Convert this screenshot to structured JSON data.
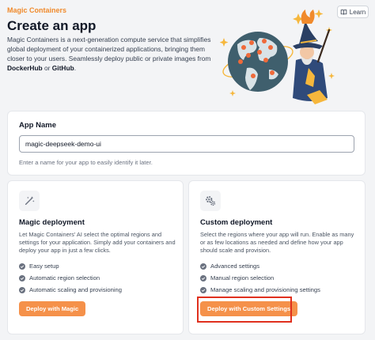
{
  "header": {
    "breadcrumb": "Magic Containers",
    "title": "Create an app",
    "intro_text": "Magic Containers is a next-generation compute service that simplifies global deployment of your containerized applications, bringing them closer to your users. Seamlessly deploy public or private images from ",
    "intro_dockerhub": "DockerHub",
    "intro_or": " or ",
    "intro_github": "GitHub",
    "intro_end": ".",
    "learn_label": "Learn"
  },
  "app_name": {
    "label": "App Name",
    "value": "magic-deepseek-demo-ui",
    "help": "Enter a name for your app to easily identify it later."
  },
  "magic_deployment": {
    "title": "Magic deployment",
    "description": "Let Magic Containers' AI select the optimal regions and settings for your application. Simply add your containers and deploy your app in just a few clicks.",
    "features": [
      "Easy setup",
      "Automatic region selection",
      "Automatic scaling and provisioning"
    ],
    "button_label": "Deploy with Magic"
  },
  "custom_deployment": {
    "title": "Custom deployment",
    "description": "Select the regions where your app will run. Enable as many or as few locations as needed and define how your app should scale and provision.",
    "features": [
      "Advanced settings",
      "Manual region selection",
      "Manage scaling and provisioning settings"
    ],
    "button_label": "Deploy with Custom Settings"
  },
  "colors": {
    "accent": "#f08a2c",
    "button": "#f5914a",
    "highlight": "#e0301e"
  }
}
